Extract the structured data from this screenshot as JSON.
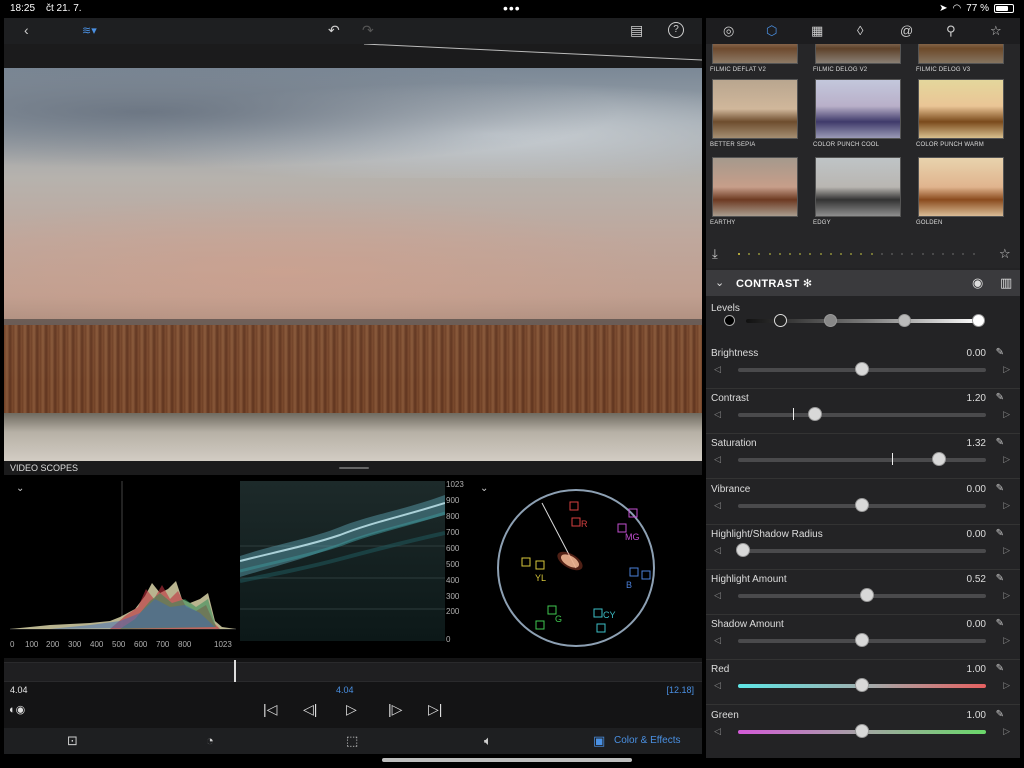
{
  "status_bar": {
    "time": "18:25",
    "date": "čt 21. 7.",
    "battery": "77 %",
    "battery_level": 0.77
  },
  "top_toolbar": {
    "back_icon": "chevron-left-icon",
    "clip_icon": "clip-icon",
    "undo_icon": "undo-icon",
    "redo_icon": "redo-icon",
    "notes_icon": "clipboard-icon",
    "help_icon": "help-icon"
  },
  "scopes": {
    "title": "VIDEO SCOPES",
    "histogram_ticks": [
      "0",
      "100",
      "200",
      "300",
      "400",
      "500",
      "600",
      "700",
      "800",
      "1023"
    ],
    "waveform_ticks": [
      "1023",
      "900",
      "800",
      "700",
      "600",
      "500",
      "400",
      "300",
      "200",
      "0"
    ],
    "vectorscope_labels": [
      "R",
      "MG",
      "B",
      "CY",
      "G",
      "YL"
    ]
  },
  "timeline": {
    "current_left": "4.04",
    "current_center": "4.04",
    "duration": "[12.18]",
    "playhead_fraction": 0.33
  },
  "bottom_bar": {
    "active_label": "Color & Effects"
  },
  "right_tabs": [
    "palette-icon",
    "cube-icon",
    "grid-icon",
    "drop-icon",
    "swirl-icon",
    "keyhole-icon",
    "star-icon"
  ],
  "presets": [
    {
      "label": "FILMIC DEFLAT V2"
    },
    {
      "label": "FILMIC DELOG V2"
    },
    {
      "label": "FILMIC DELOG V3"
    },
    {
      "label": "BETTER SEPIA"
    },
    {
      "label": "COLOR PUNCH COOL"
    },
    {
      "label": "COLOR PUNCH WARM"
    },
    {
      "label": "EARTHY"
    },
    {
      "label": "EDGY"
    },
    {
      "label": "GOLDEN"
    }
  ],
  "contrast": {
    "title": "CONTRAST ✻",
    "levels_label": "Levels",
    "params": [
      {
        "name": "Brightness",
        "value": "0.00",
        "fraction": 0.5
      },
      {
        "name": "Contrast",
        "value": "1.20",
        "fraction": 0.31
      },
      {
        "name": "Saturation",
        "value": "1.32",
        "fraction": 0.81
      },
      {
        "name": "Vibrance",
        "value": "0.00",
        "fraction": 0.5
      },
      {
        "name": "Highlight/Shadow Radius",
        "value": "0.00",
        "fraction": 0.02
      },
      {
        "name": "Highlight Amount",
        "value": "0.52",
        "fraction": 0.52
      },
      {
        "name": "Shadow Amount",
        "value": "0.00",
        "fraction": 0.5
      },
      {
        "name": "Red",
        "value": "1.00",
        "fraction": 0.5
      },
      {
        "name": "Green",
        "value": "1.00",
        "fraction": 0.5
      }
    ]
  }
}
